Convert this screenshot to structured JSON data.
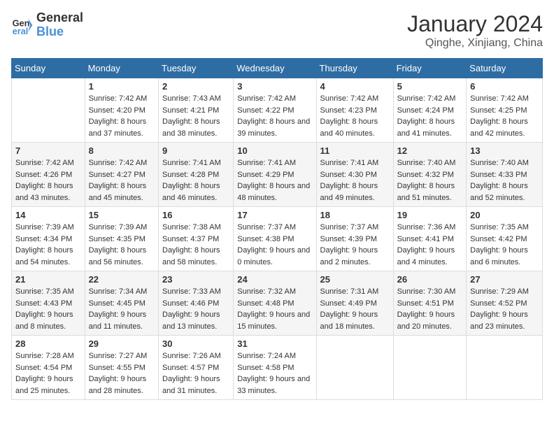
{
  "header": {
    "logo_line1": "General",
    "logo_line2": "Blue",
    "title": "January 2024",
    "subtitle": "Qinghe, Xinjiang, China"
  },
  "calendar": {
    "days_of_week": [
      "Sunday",
      "Monday",
      "Tuesday",
      "Wednesday",
      "Thursday",
      "Friday",
      "Saturday"
    ],
    "weeks": [
      [
        {
          "day": "",
          "sunrise": "",
          "sunset": "",
          "daylight": ""
        },
        {
          "day": "1",
          "sunrise": "Sunrise: 7:42 AM",
          "sunset": "Sunset: 4:20 PM",
          "daylight": "Daylight: 8 hours and 37 minutes."
        },
        {
          "day": "2",
          "sunrise": "Sunrise: 7:43 AM",
          "sunset": "Sunset: 4:21 PM",
          "daylight": "Daylight: 8 hours and 38 minutes."
        },
        {
          "day": "3",
          "sunrise": "Sunrise: 7:42 AM",
          "sunset": "Sunset: 4:22 PM",
          "daylight": "Daylight: 8 hours and 39 minutes."
        },
        {
          "day": "4",
          "sunrise": "Sunrise: 7:42 AM",
          "sunset": "Sunset: 4:23 PM",
          "daylight": "Daylight: 8 hours and 40 minutes."
        },
        {
          "day": "5",
          "sunrise": "Sunrise: 7:42 AM",
          "sunset": "Sunset: 4:24 PM",
          "daylight": "Daylight: 8 hours and 41 minutes."
        },
        {
          "day": "6",
          "sunrise": "Sunrise: 7:42 AM",
          "sunset": "Sunset: 4:25 PM",
          "daylight": "Daylight: 8 hours and 42 minutes."
        }
      ],
      [
        {
          "day": "7",
          "sunrise": "Sunrise: 7:42 AM",
          "sunset": "Sunset: 4:26 PM",
          "daylight": "Daylight: 8 hours and 43 minutes."
        },
        {
          "day": "8",
          "sunrise": "Sunrise: 7:42 AM",
          "sunset": "Sunset: 4:27 PM",
          "daylight": "Daylight: 8 hours and 45 minutes."
        },
        {
          "day": "9",
          "sunrise": "Sunrise: 7:41 AM",
          "sunset": "Sunset: 4:28 PM",
          "daylight": "Daylight: 8 hours and 46 minutes."
        },
        {
          "day": "10",
          "sunrise": "Sunrise: 7:41 AM",
          "sunset": "Sunset: 4:29 PM",
          "daylight": "Daylight: 8 hours and 48 minutes."
        },
        {
          "day": "11",
          "sunrise": "Sunrise: 7:41 AM",
          "sunset": "Sunset: 4:30 PM",
          "daylight": "Daylight: 8 hours and 49 minutes."
        },
        {
          "day": "12",
          "sunrise": "Sunrise: 7:40 AM",
          "sunset": "Sunset: 4:32 PM",
          "daylight": "Daylight: 8 hours and 51 minutes."
        },
        {
          "day": "13",
          "sunrise": "Sunrise: 7:40 AM",
          "sunset": "Sunset: 4:33 PM",
          "daylight": "Daylight: 8 hours and 52 minutes."
        }
      ],
      [
        {
          "day": "14",
          "sunrise": "Sunrise: 7:39 AM",
          "sunset": "Sunset: 4:34 PM",
          "daylight": "Daylight: 8 hours and 54 minutes."
        },
        {
          "day": "15",
          "sunrise": "Sunrise: 7:39 AM",
          "sunset": "Sunset: 4:35 PM",
          "daylight": "Daylight: 8 hours and 56 minutes."
        },
        {
          "day": "16",
          "sunrise": "Sunrise: 7:38 AM",
          "sunset": "Sunset: 4:37 PM",
          "daylight": "Daylight: 8 hours and 58 minutes."
        },
        {
          "day": "17",
          "sunrise": "Sunrise: 7:37 AM",
          "sunset": "Sunset: 4:38 PM",
          "daylight": "Daylight: 9 hours and 0 minutes."
        },
        {
          "day": "18",
          "sunrise": "Sunrise: 7:37 AM",
          "sunset": "Sunset: 4:39 PM",
          "daylight": "Daylight: 9 hours and 2 minutes."
        },
        {
          "day": "19",
          "sunrise": "Sunrise: 7:36 AM",
          "sunset": "Sunset: 4:41 PM",
          "daylight": "Daylight: 9 hours and 4 minutes."
        },
        {
          "day": "20",
          "sunrise": "Sunrise: 7:35 AM",
          "sunset": "Sunset: 4:42 PM",
          "daylight": "Daylight: 9 hours and 6 minutes."
        }
      ],
      [
        {
          "day": "21",
          "sunrise": "Sunrise: 7:35 AM",
          "sunset": "Sunset: 4:43 PM",
          "daylight": "Daylight: 9 hours and 8 minutes."
        },
        {
          "day": "22",
          "sunrise": "Sunrise: 7:34 AM",
          "sunset": "Sunset: 4:45 PM",
          "daylight": "Daylight: 9 hours and 11 minutes."
        },
        {
          "day": "23",
          "sunrise": "Sunrise: 7:33 AM",
          "sunset": "Sunset: 4:46 PM",
          "daylight": "Daylight: 9 hours and 13 minutes."
        },
        {
          "day": "24",
          "sunrise": "Sunrise: 7:32 AM",
          "sunset": "Sunset: 4:48 PM",
          "daylight": "Daylight: 9 hours and 15 minutes."
        },
        {
          "day": "25",
          "sunrise": "Sunrise: 7:31 AM",
          "sunset": "Sunset: 4:49 PM",
          "daylight": "Daylight: 9 hours and 18 minutes."
        },
        {
          "day": "26",
          "sunrise": "Sunrise: 7:30 AM",
          "sunset": "Sunset: 4:51 PM",
          "daylight": "Daylight: 9 hours and 20 minutes."
        },
        {
          "day": "27",
          "sunrise": "Sunrise: 7:29 AM",
          "sunset": "Sunset: 4:52 PM",
          "daylight": "Daylight: 9 hours and 23 minutes."
        }
      ],
      [
        {
          "day": "28",
          "sunrise": "Sunrise: 7:28 AM",
          "sunset": "Sunset: 4:54 PM",
          "daylight": "Daylight: 9 hours and 25 minutes."
        },
        {
          "day": "29",
          "sunrise": "Sunrise: 7:27 AM",
          "sunset": "Sunset: 4:55 PM",
          "daylight": "Daylight: 9 hours and 28 minutes."
        },
        {
          "day": "30",
          "sunrise": "Sunrise: 7:26 AM",
          "sunset": "Sunset: 4:57 PM",
          "daylight": "Daylight: 9 hours and 31 minutes."
        },
        {
          "day": "31",
          "sunrise": "Sunrise: 7:24 AM",
          "sunset": "Sunset: 4:58 PM",
          "daylight": "Daylight: 9 hours and 33 minutes."
        },
        {
          "day": "",
          "sunrise": "",
          "sunset": "",
          "daylight": ""
        },
        {
          "day": "",
          "sunrise": "",
          "sunset": "",
          "daylight": ""
        },
        {
          "day": "",
          "sunrise": "",
          "sunset": "",
          "daylight": ""
        }
      ]
    ]
  }
}
